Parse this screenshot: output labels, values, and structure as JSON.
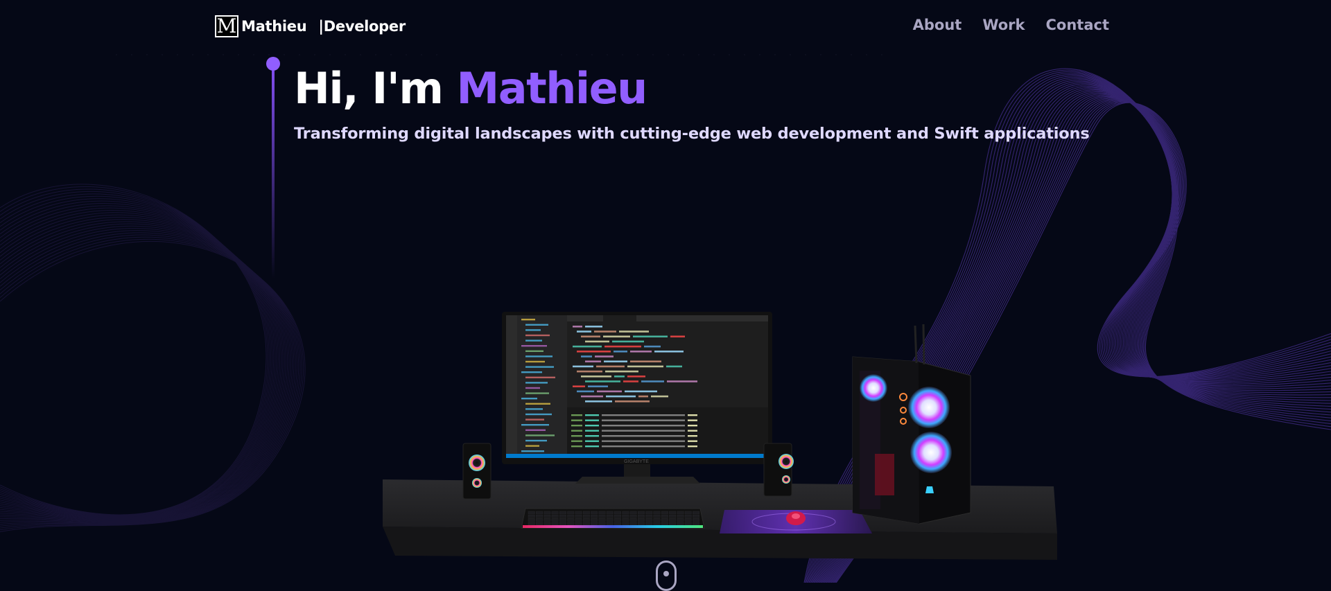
{
  "nav": {
    "logo_letter": "M",
    "logo_name": "Mathieu",
    "logo_separator": "|",
    "logo_role": "Developer",
    "links": [
      {
        "label": "About"
      },
      {
        "label": "Work"
      },
      {
        "label": "Contact"
      }
    ]
  },
  "hero": {
    "greeting": "Hi, I'm",
    "name": "Mathieu",
    "subtitle": "Transforming digital landscapes with cutting-edge web development and Swift applications"
  },
  "colors": {
    "background": "#050816",
    "accent": "#915eff",
    "nav_text": "#aaa6c3",
    "subtitle_text": "#dfd9ff"
  },
  "scene": {
    "monitor_brand": "GIGABYTE"
  }
}
